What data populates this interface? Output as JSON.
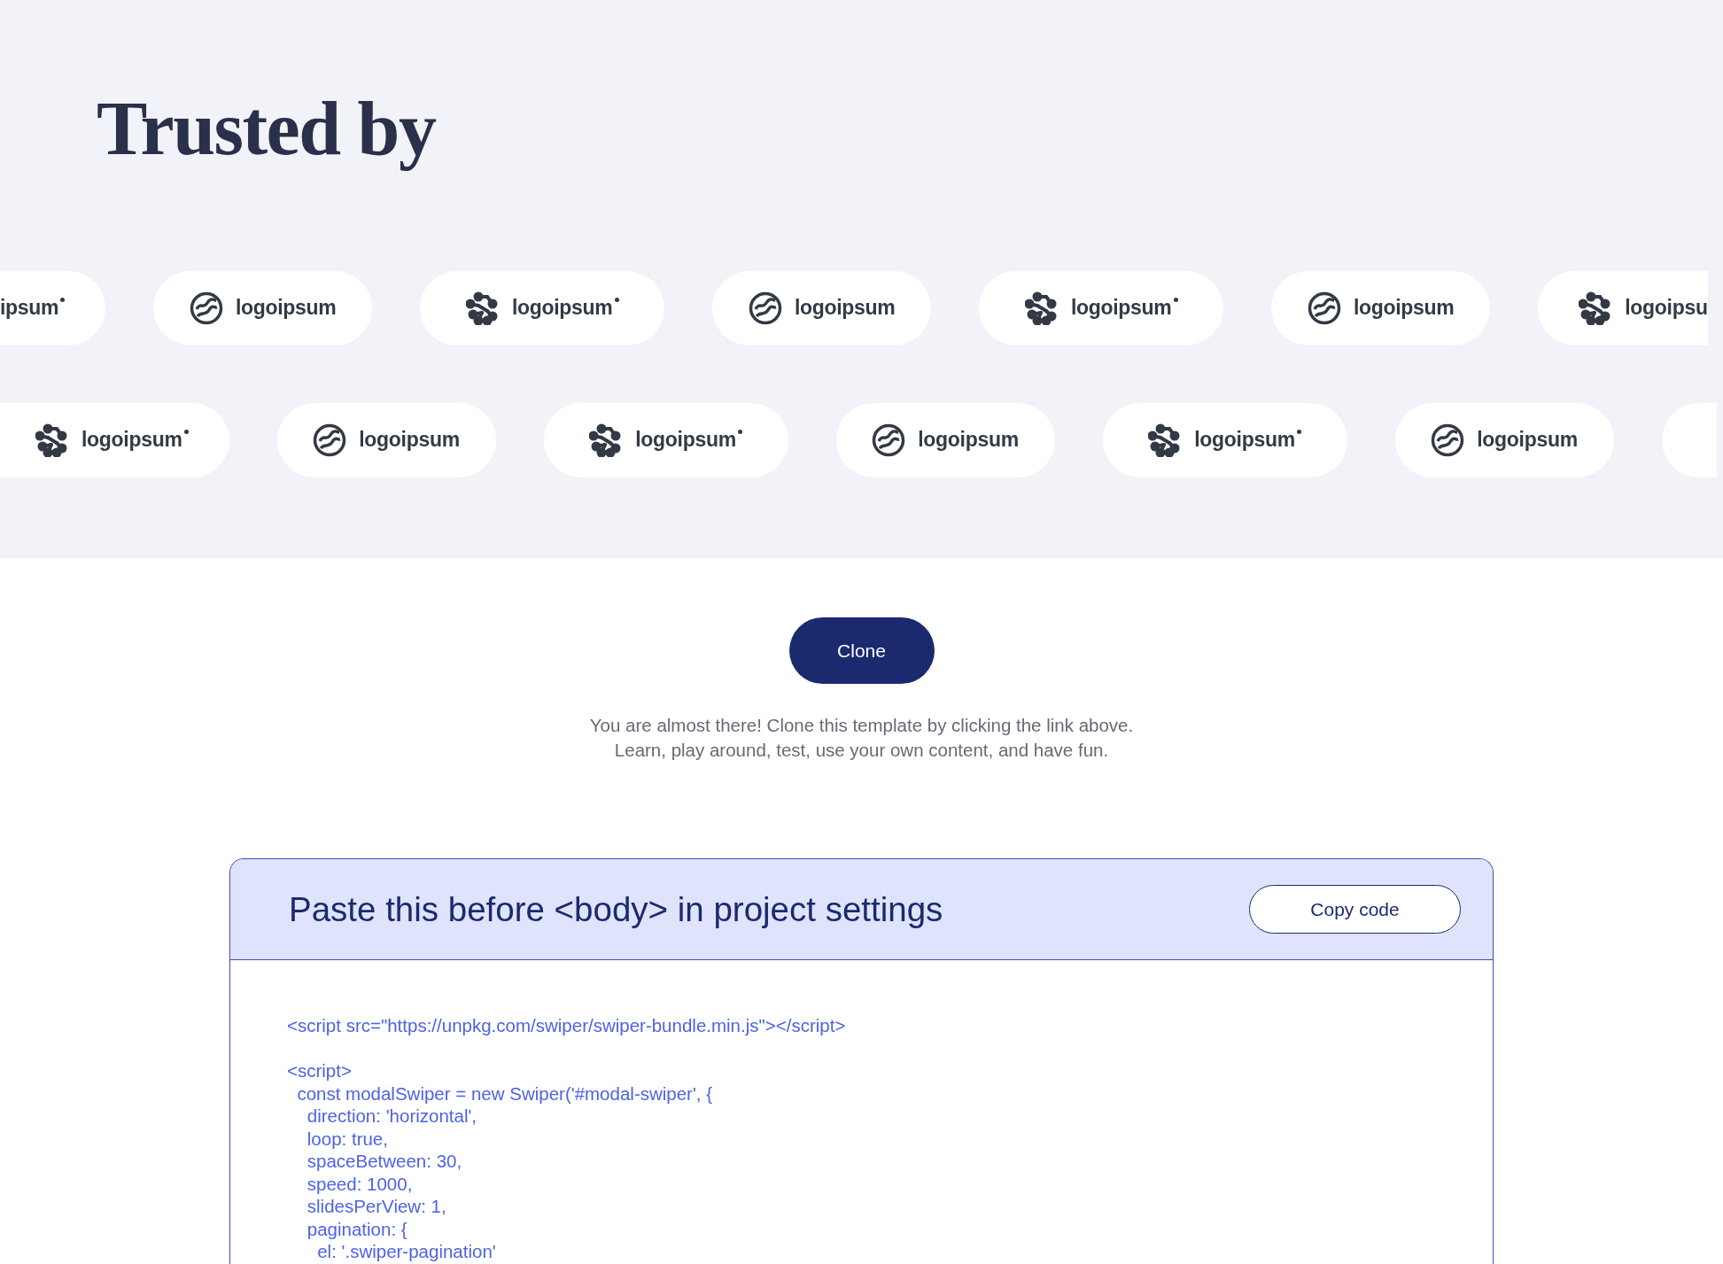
{
  "trusted_section": {
    "heading": "Trusted by",
    "logo_rows": [
      {
        "logos": [
          {
            "kind": "fragment",
            "text": "ipsum",
            "registered": true,
            "cut_left": true,
            "cut_right": false
          },
          {
            "kind": "circle",
            "text": "logoipsum",
            "registered": false,
            "cut_left": false,
            "cut_right": false
          },
          {
            "kind": "dots",
            "text": "logoipsum",
            "registered": true,
            "cut_left": false,
            "cut_right": false
          },
          {
            "kind": "circle",
            "text": "logoipsum",
            "registered": false,
            "cut_left": false,
            "cut_right": false
          },
          {
            "kind": "dots",
            "text": "logoipsum",
            "registered": true,
            "cut_left": false,
            "cut_right": false
          },
          {
            "kind": "circle",
            "text": "logoipsum",
            "registered": false,
            "cut_left": false,
            "cut_right": false
          },
          {
            "kind": "dots",
            "text": "logoipsu",
            "registered": false,
            "cut_left": false,
            "cut_right": true
          }
        ]
      },
      {
        "logos": [
          {
            "kind": "dots",
            "text": "logoipsum",
            "registered": true,
            "cut_left": true,
            "cut_right": false
          },
          {
            "kind": "circle",
            "text": "logoipsum",
            "registered": false,
            "cut_left": false,
            "cut_right": false
          },
          {
            "kind": "dots",
            "text": "logoipsum",
            "registered": true,
            "cut_left": false,
            "cut_right": false
          },
          {
            "kind": "circle",
            "text": "logoipsum",
            "registered": false,
            "cut_left": false,
            "cut_right": false
          },
          {
            "kind": "dots",
            "text": "logoipsum",
            "registered": true,
            "cut_left": false,
            "cut_right": false
          },
          {
            "kind": "circle",
            "text": "logoipsum",
            "registered": false,
            "cut_left": false,
            "cut_right": false
          },
          {
            "kind": "edge",
            "cut_left": false,
            "cut_right": true
          }
        ]
      }
    ]
  },
  "clone": {
    "button": "Clone",
    "message": [
      "You are almost there! Clone this template by clicking the link above.",
      "Learn, play around, test, use your own content, and have fun."
    ]
  },
  "code_panel": {
    "title": "Paste this before <body> in project settings",
    "copy_button": "Copy code",
    "blocks": [
      [
        "<script src=\"https://unpkg.com/swiper/swiper-bundle.min.js\"></script>"
      ],
      [
        "<script>",
        "  const modalSwiper = new Swiper('#modal-swiper', {",
        "    direction: 'horizontal',",
        "    loop: true,",
        "    spaceBetween: 30,",
        "    speed: 1000,",
        "    slidesPerView: 1,",
        "    pagination: {",
        "      el: '.swiper-pagination'"
      ]
    ]
  }
}
